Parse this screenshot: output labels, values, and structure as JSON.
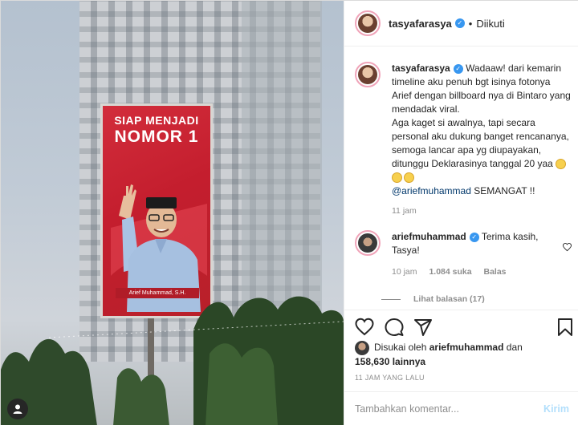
{
  "header": {
    "username": "tasyafarasya",
    "separator": "•",
    "follow_status": "Diikuti"
  },
  "caption": {
    "username": "tasyafarasya",
    "text": "Wadaaw! dari kemarin timeline aku penuh bgt isinya fotonya Arief dengan billboard nya di Bintaro yang mendadak viral.",
    "text2": "Aga kaget si awalnya, tapi secara personal aku dukung banget rencananya, semoga lancar apa yg diupayakan, ditunggu Deklarasinya tanggal 20 yaa",
    "mention": "@ariefmuhammad",
    "text3": " SEMANGAT !!",
    "time": "11 jam"
  },
  "comment": {
    "username": "ariefmuhammad",
    "text": "Terima kasih, Tasya!",
    "time": "10 jam",
    "likes": "1.084 suka",
    "reply": "Balas",
    "view_replies": "Lihat balasan (17)"
  },
  "likes": {
    "prefix": "Disukai oleh",
    "user": "ariefmuhammad",
    "and": "dan",
    "others": "158,630 lainnya"
  },
  "timestamp": "11 JAM YANG LALU",
  "add_comment": {
    "placeholder": "Tambahkan komentar...",
    "post_label": "Kirim"
  },
  "billboard": {
    "line1": "SIAP MENJADI",
    "line2": "NOMOR 1",
    "name": "Arief Muhammad, S.H."
  },
  "colors": {
    "verified": "#3897f0",
    "billboard_red": "#c41e2e",
    "post_button": "#b2dffc"
  }
}
